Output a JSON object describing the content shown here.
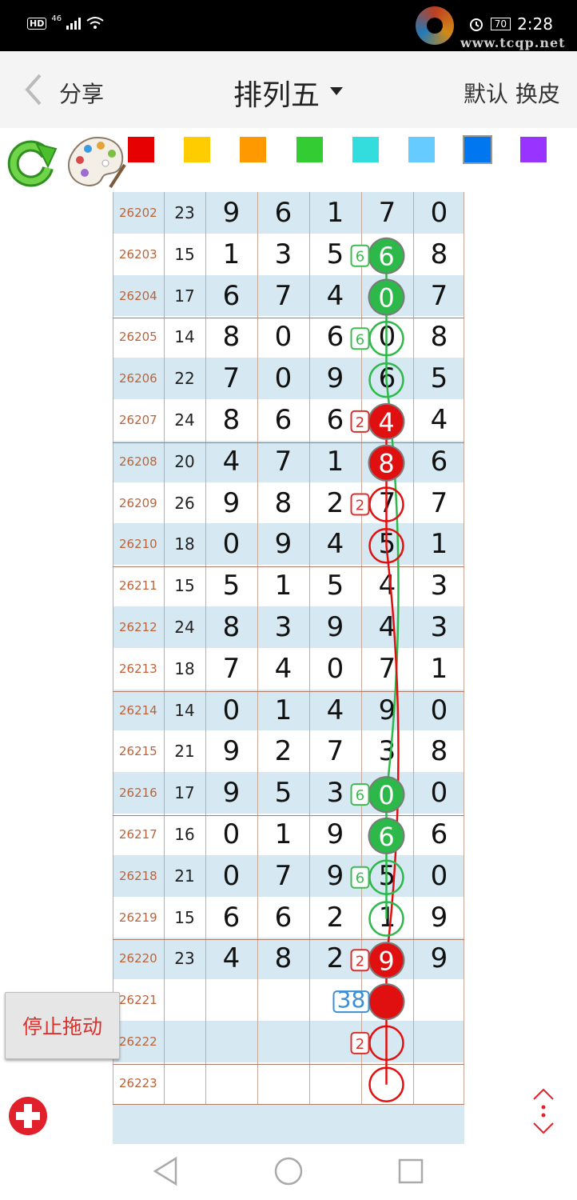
{
  "status_bar": {
    "hd": "HD",
    "network": "46",
    "battery": "70",
    "time": "2:28"
  },
  "watermark": {
    "url": "www.tcqp.net"
  },
  "header": {
    "share": "分享",
    "title": "排列五",
    "default_skin": "默认 换皮"
  },
  "colors": {
    "accent_red": "#e01010",
    "accent_green": "#2db84a",
    "issue_text": "#b9633a",
    "swatches": [
      "#e60000",
      "#ffcc00",
      "#ff9900",
      "#33cc33",
      "#33dddd",
      "#66ccff",
      "#0077ee",
      "#9933ff"
    ]
  },
  "selected_swatch": 6,
  "rows": [
    {
      "issue": "26202",
      "sum": "23",
      "d": [
        "9",
        "6",
        "1",
        "7",
        "0"
      ]
    },
    {
      "issue": "26203",
      "sum": "15",
      "d": [
        "1",
        "3",
        "5",
        "6",
        "8"
      ]
    },
    {
      "issue": "26204",
      "sum": "17",
      "d": [
        "6",
        "7",
        "4",
        "0",
        "7"
      ]
    },
    {
      "issue": "26205",
      "sum": "14",
      "d": [
        "8",
        "0",
        "6",
        "0",
        "8"
      ]
    },
    {
      "issue": "26206",
      "sum": "22",
      "d": [
        "7",
        "0",
        "9",
        "6",
        "5"
      ]
    },
    {
      "issue": "26207",
      "sum": "24",
      "d": [
        "8",
        "6",
        "6",
        "4",
        "4"
      ]
    },
    {
      "issue": "26208",
      "sum": "20",
      "d": [
        "4",
        "7",
        "1",
        "8",
        "6"
      ]
    },
    {
      "issue": "26209",
      "sum": "26",
      "d": [
        "9",
        "8",
        "2",
        "7",
        "7"
      ]
    },
    {
      "issue": "26210",
      "sum": "18",
      "d": [
        "0",
        "9",
        "4",
        "5",
        "1"
      ]
    },
    {
      "issue": "26211",
      "sum": "15",
      "d": [
        "5",
        "1",
        "5",
        "4",
        "3"
      ]
    },
    {
      "issue": "26212",
      "sum": "24",
      "d": [
        "8",
        "3",
        "9",
        "4",
        "3"
      ]
    },
    {
      "issue": "26213",
      "sum": "18",
      "d": [
        "7",
        "4",
        "0",
        "7",
        "1"
      ]
    },
    {
      "issue": "26214",
      "sum": "14",
      "d": [
        "0",
        "1",
        "4",
        "9",
        "0"
      ]
    },
    {
      "issue": "26215",
      "sum": "21",
      "d": [
        "9",
        "2",
        "7",
        "3",
        "8"
      ]
    },
    {
      "issue": "26216",
      "sum": "17",
      "d": [
        "9",
        "5",
        "3",
        "0",
        "0"
      ]
    },
    {
      "issue": "26217",
      "sum": "16",
      "d": [
        "0",
        "1",
        "9",
        "6",
        "6"
      ]
    },
    {
      "issue": "26218",
      "sum": "21",
      "d": [
        "0",
        "7",
        "9",
        "5",
        "0"
      ]
    },
    {
      "issue": "26219",
      "sum": "15",
      "d": [
        "6",
        "6",
        "2",
        "1",
        "9"
      ]
    },
    {
      "issue": "26220",
      "sum": "23",
      "d": [
        "4",
        "8",
        "2",
        "9",
        "9"
      ]
    },
    {
      "issue": "26221",
      "sum": "",
      "d": [
        "",
        "",
        "",
        "",
        ""
      ]
    },
    {
      "issue": "26222",
      "sum": "",
      "d": [
        "",
        "",
        "",
        "",
        ""
      ]
    },
    {
      "issue": "26223",
      "sum": "",
      "d": [
        "",
        "",
        "",
        "",
        ""
      ]
    }
  ],
  "markers": [
    {
      "row": 1,
      "style": "green-filled"
    },
    {
      "row": 2,
      "style": "green-filled"
    },
    {
      "row": 3,
      "style": "green-ring"
    },
    {
      "row": 4,
      "style": "green-ring"
    },
    {
      "row": 5,
      "style": "red-filled"
    },
    {
      "row": 6,
      "style": "red-filled"
    },
    {
      "row": 7,
      "style": "red-ring"
    },
    {
      "row": 8,
      "style": "red-ring"
    },
    {
      "row": 14,
      "style": "green-filled"
    },
    {
      "row": 15,
      "style": "green-filled"
    },
    {
      "row": 16,
      "style": "green-ring"
    },
    {
      "row": 17,
      "style": "green-ring"
    },
    {
      "row": 18,
      "style": "red-filled"
    },
    {
      "row": 19,
      "style": "red-solid"
    },
    {
      "row": 20,
      "style": "red-ring"
    },
    {
      "row": 21,
      "style": "red-ring"
    }
  ],
  "badges": [
    {
      "row": 1,
      "text": "6",
      "color": "green"
    },
    {
      "row": 3,
      "text": "6",
      "color": "green"
    },
    {
      "row": 5,
      "text": "2",
      "color": "red"
    },
    {
      "row": 7,
      "text": "2",
      "color": "red"
    },
    {
      "row": 14,
      "text": "6",
      "color": "green"
    },
    {
      "row": 16,
      "text": "6",
      "color": "green"
    },
    {
      "row": 18,
      "text": "2",
      "color": "red"
    },
    {
      "row": 19,
      "text": "38",
      "color": "blue"
    },
    {
      "row": 20,
      "text": "2",
      "color": "red"
    }
  ],
  "buttons": {
    "stop_drag": "停止拖动"
  }
}
